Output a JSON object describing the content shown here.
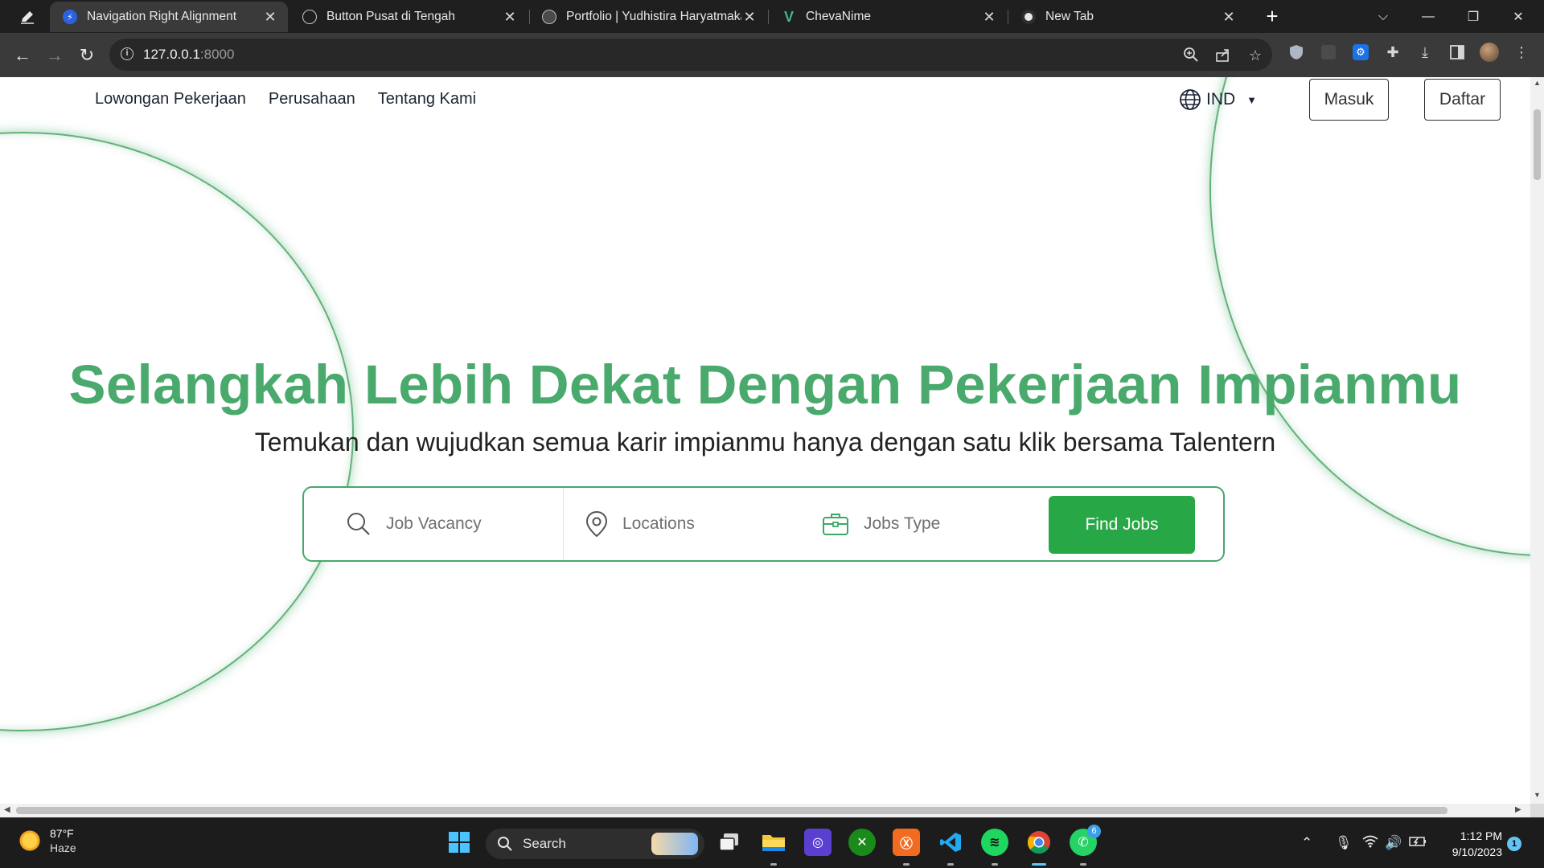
{
  "browser": {
    "tabs": [
      {
        "title": "Navigation Right Alignment",
        "active": true
      },
      {
        "title": "Button Pusat di Tengah",
        "active": false
      },
      {
        "title": "Portfolio | Yudhistira Haryatmaka",
        "active": false
      },
      {
        "title": "ChevaNime",
        "active": false
      },
      {
        "title": "New Tab",
        "active": false
      }
    ],
    "close_glyph": "✕",
    "address": {
      "host": "127.0.0.1",
      "port": ":8000"
    }
  },
  "site": {
    "nav": [
      {
        "label": "Lowongan Pekerjaan"
      },
      {
        "label": "Perusahaan"
      },
      {
        "label": "Tentang Kami"
      }
    ],
    "language": "IND",
    "login_label": "Masuk",
    "register_label": "Daftar",
    "hero": {
      "title": "Selangkah Lebih Dekat Dengan Pekerjaan Impianmu",
      "subtitle": "Temukan dan wujudkan semua karir impianmu hanya dengan satu klik bersama Talentern"
    },
    "search": {
      "vacancy_placeholder": "Job Vacancy",
      "location_placeholder": "Locations",
      "type_placeholder": "Jobs Type",
      "button_label": "Find Jobs"
    },
    "accent_color": "#4aa96c",
    "button_color": "#27a745"
  },
  "taskbar": {
    "weather": {
      "temp": "87°F",
      "condition": "Haze"
    },
    "search_label": "Search",
    "clock": {
      "time": "1:12 PM",
      "date": "9/10/2023"
    },
    "notifications": "1",
    "whatsapp_badge": "6"
  }
}
